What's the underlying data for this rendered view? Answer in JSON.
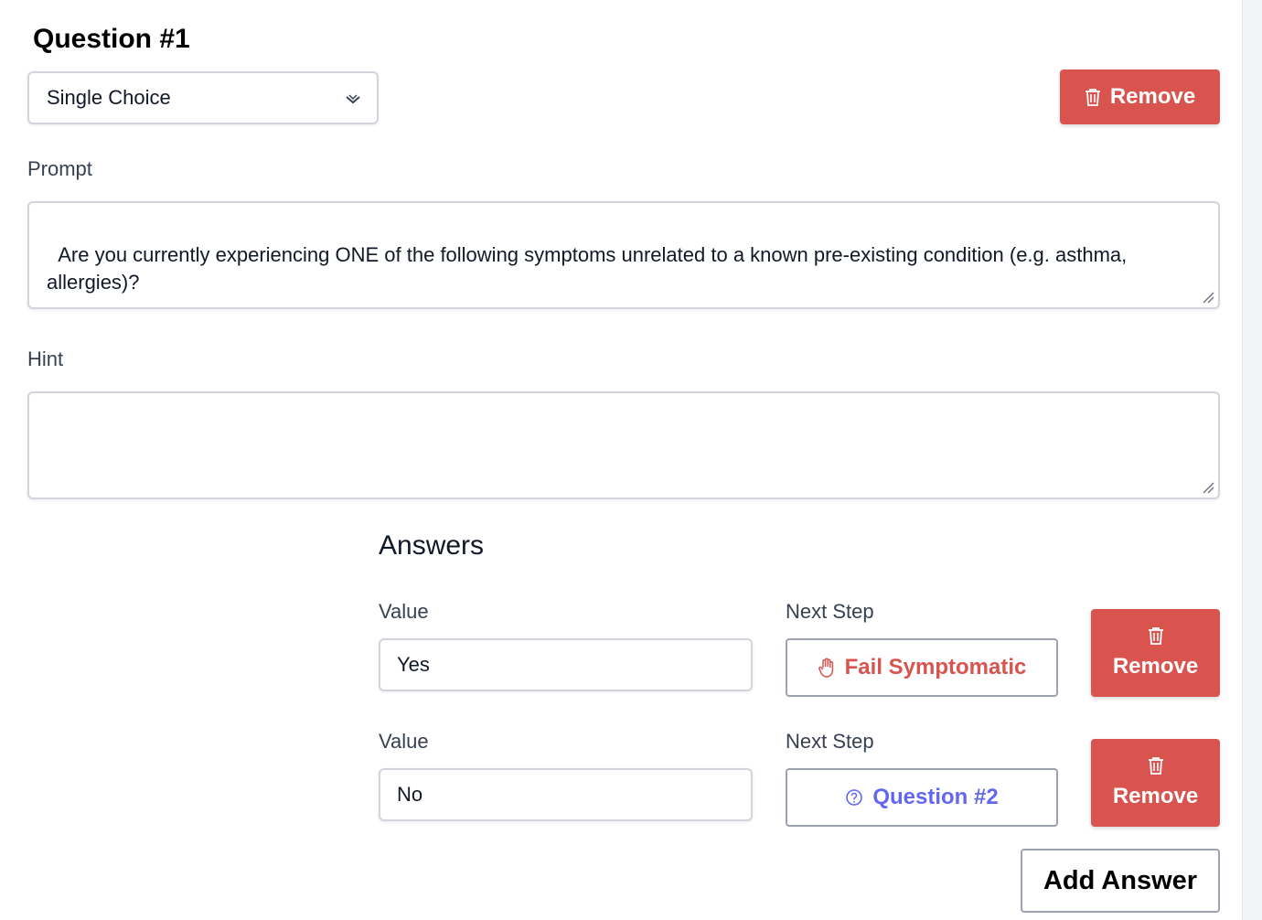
{
  "question": {
    "title": "Question #1",
    "type_select": {
      "value": "Single Choice"
    },
    "remove_label": "Remove",
    "prompt": {
      "label": "Prompt",
      "value": "Are you currently experiencing ONE of the following symptoms unrelated to a known pre-existing condition (e.g. asthma, allergies)?\n\n- New cough"
    },
    "hint": {
      "label": "Hint",
      "value": ""
    }
  },
  "answers": {
    "heading": "Answers",
    "value_label": "Value",
    "next_step_label": "Next Step",
    "remove_label": "Remove",
    "add_label": "Add Answer",
    "items": [
      {
        "value": "Yes",
        "next_step": "Fail Symptomatic",
        "next_step_icon": "hand-stop-icon"
      },
      {
        "value": "No",
        "next_step": "Question #2",
        "next_step_icon": "question-circle-icon"
      }
    ]
  },
  "colors": {
    "danger": "#d9534f",
    "link": "#6366f1",
    "border": "#d1d5db"
  }
}
